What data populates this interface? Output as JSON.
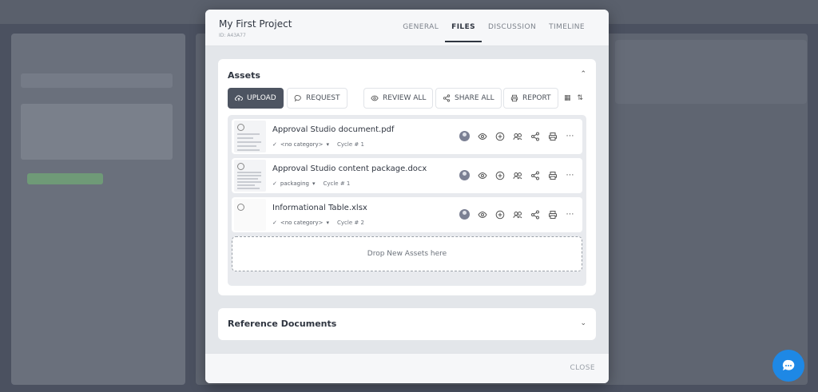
{
  "project": {
    "title": "My First Project",
    "id": "ID: A43A77"
  },
  "tabs": [
    {
      "label": "GENERAL"
    },
    {
      "label": "FILES"
    },
    {
      "label": "DISCUSSION"
    },
    {
      "label": "TIMELINE"
    }
  ],
  "assets": {
    "title": "Assets",
    "toolbar": {
      "upload": "UPLOAD",
      "request": "REQUEST",
      "review_all": "REVIEW ALL",
      "share_all": "SHARE ALL",
      "report": "REPORT"
    },
    "files": [
      {
        "name": "Approval Studio document.pdf",
        "category": "<no category>",
        "cycle": "Cycle # 1"
      },
      {
        "name": "Approval Studio content package.docx",
        "category": "packaging",
        "cycle": "Cycle # 1"
      },
      {
        "name": "Informational Table.xlsx",
        "category": "<no category>",
        "cycle": "Cycle # 2"
      }
    ],
    "drop_text": "Drop New Assets here"
  },
  "reference": {
    "title": "Reference Documents"
  },
  "footer": {
    "close": "CLOSE"
  },
  "colors": {
    "primary_button": "#4d5461",
    "chat_button": "#1e88e5",
    "active_tab": "#2f3540"
  }
}
